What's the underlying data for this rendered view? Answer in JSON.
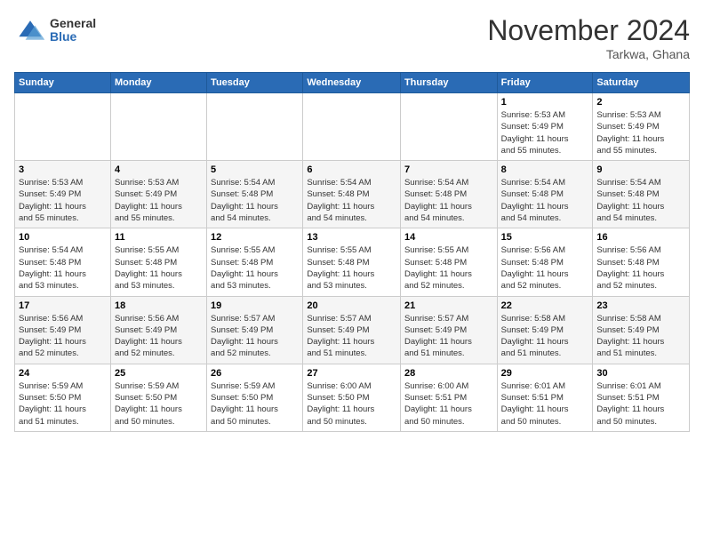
{
  "logo": {
    "general": "General",
    "blue": "Blue"
  },
  "title": "November 2024",
  "location": "Tarkwa, Ghana",
  "days_of_week": [
    "Sunday",
    "Monday",
    "Tuesday",
    "Wednesday",
    "Thursday",
    "Friday",
    "Saturday"
  ],
  "weeks": [
    [
      {
        "day": "",
        "info": ""
      },
      {
        "day": "",
        "info": ""
      },
      {
        "day": "",
        "info": ""
      },
      {
        "day": "",
        "info": ""
      },
      {
        "day": "",
        "info": ""
      },
      {
        "day": "1",
        "info": "Sunrise: 5:53 AM\nSunset: 5:49 PM\nDaylight: 11 hours\nand 55 minutes."
      },
      {
        "day": "2",
        "info": "Sunrise: 5:53 AM\nSunset: 5:49 PM\nDaylight: 11 hours\nand 55 minutes."
      }
    ],
    [
      {
        "day": "3",
        "info": "Sunrise: 5:53 AM\nSunset: 5:49 PM\nDaylight: 11 hours\nand 55 minutes."
      },
      {
        "day": "4",
        "info": "Sunrise: 5:53 AM\nSunset: 5:49 PM\nDaylight: 11 hours\nand 55 minutes."
      },
      {
        "day": "5",
        "info": "Sunrise: 5:54 AM\nSunset: 5:48 PM\nDaylight: 11 hours\nand 54 minutes."
      },
      {
        "day": "6",
        "info": "Sunrise: 5:54 AM\nSunset: 5:48 PM\nDaylight: 11 hours\nand 54 minutes."
      },
      {
        "day": "7",
        "info": "Sunrise: 5:54 AM\nSunset: 5:48 PM\nDaylight: 11 hours\nand 54 minutes."
      },
      {
        "day": "8",
        "info": "Sunrise: 5:54 AM\nSunset: 5:48 PM\nDaylight: 11 hours\nand 54 minutes."
      },
      {
        "day": "9",
        "info": "Sunrise: 5:54 AM\nSunset: 5:48 PM\nDaylight: 11 hours\nand 54 minutes."
      }
    ],
    [
      {
        "day": "10",
        "info": "Sunrise: 5:54 AM\nSunset: 5:48 PM\nDaylight: 11 hours\nand 53 minutes."
      },
      {
        "day": "11",
        "info": "Sunrise: 5:55 AM\nSunset: 5:48 PM\nDaylight: 11 hours\nand 53 minutes."
      },
      {
        "day": "12",
        "info": "Sunrise: 5:55 AM\nSunset: 5:48 PM\nDaylight: 11 hours\nand 53 minutes."
      },
      {
        "day": "13",
        "info": "Sunrise: 5:55 AM\nSunset: 5:48 PM\nDaylight: 11 hours\nand 53 minutes."
      },
      {
        "day": "14",
        "info": "Sunrise: 5:55 AM\nSunset: 5:48 PM\nDaylight: 11 hours\nand 52 minutes."
      },
      {
        "day": "15",
        "info": "Sunrise: 5:56 AM\nSunset: 5:48 PM\nDaylight: 11 hours\nand 52 minutes."
      },
      {
        "day": "16",
        "info": "Sunrise: 5:56 AM\nSunset: 5:48 PM\nDaylight: 11 hours\nand 52 minutes."
      }
    ],
    [
      {
        "day": "17",
        "info": "Sunrise: 5:56 AM\nSunset: 5:49 PM\nDaylight: 11 hours\nand 52 minutes."
      },
      {
        "day": "18",
        "info": "Sunrise: 5:56 AM\nSunset: 5:49 PM\nDaylight: 11 hours\nand 52 minutes."
      },
      {
        "day": "19",
        "info": "Sunrise: 5:57 AM\nSunset: 5:49 PM\nDaylight: 11 hours\nand 52 minutes."
      },
      {
        "day": "20",
        "info": "Sunrise: 5:57 AM\nSunset: 5:49 PM\nDaylight: 11 hours\nand 51 minutes."
      },
      {
        "day": "21",
        "info": "Sunrise: 5:57 AM\nSunset: 5:49 PM\nDaylight: 11 hours\nand 51 minutes."
      },
      {
        "day": "22",
        "info": "Sunrise: 5:58 AM\nSunset: 5:49 PM\nDaylight: 11 hours\nand 51 minutes."
      },
      {
        "day": "23",
        "info": "Sunrise: 5:58 AM\nSunset: 5:49 PM\nDaylight: 11 hours\nand 51 minutes."
      }
    ],
    [
      {
        "day": "24",
        "info": "Sunrise: 5:59 AM\nSunset: 5:50 PM\nDaylight: 11 hours\nand 51 minutes."
      },
      {
        "day": "25",
        "info": "Sunrise: 5:59 AM\nSunset: 5:50 PM\nDaylight: 11 hours\nand 50 minutes."
      },
      {
        "day": "26",
        "info": "Sunrise: 5:59 AM\nSunset: 5:50 PM\nDaylight: 11 hours\nand 50 minutes."
      },
      {
        "day": "27",
        "info": "Sunrise: 6:00 AM\nSunset: 5:50 PM\nDaylight: 11 hours\nand 50 minutes."
      },
      {
        "day": "28",
        "info": "Sunrise: 6:00 AM\nSunset: 5:51 PM\nDaylight: 11 hours\nand 50 minutes."
      },
      {
        "day": "29",
        "info": "Sunrise: 6:01 AM\nSunset: 5:51 PM\nDaylight: 11 hours\nand 50 minutes."
      },
      {
        "day": "30",
        "info": "Sunrise: 6:01 AM\nSunset: 5:51 PM\nDaylight: 11 hours\nand 50 minutes."
      }
    ]
  ]
}
